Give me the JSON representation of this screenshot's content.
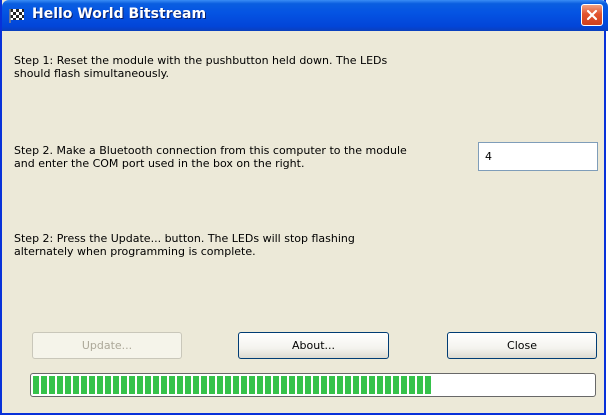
{
  "window": {
    "title": "Hello World Bitstream",
    "icon": "checkered-flag-icon",
    "close_icon": "close-icon"
  },
  "steps": {
    "step1": "Step 1: Reset the module with the pushbutton held down.  The LEDs\nshould flash simultaneously.",
    "step2": "Step 2. Make a Bluetooth connection from this computer to the module\nand enter the COM port used in the box on the right.",
    "step3": "Step 2: Press the Update... button.    The LEDs will stop flashing\nalternately when programming is complete."
  },
  "com_port": {
    "value": "4"
  },
  "buttons": {
    "update": "Update...",
    "about": "About...",
    "close": "Close"
  },
  "progress": {
    "fraction": 0.72,
    "color": "#35c24a"
  }
}
